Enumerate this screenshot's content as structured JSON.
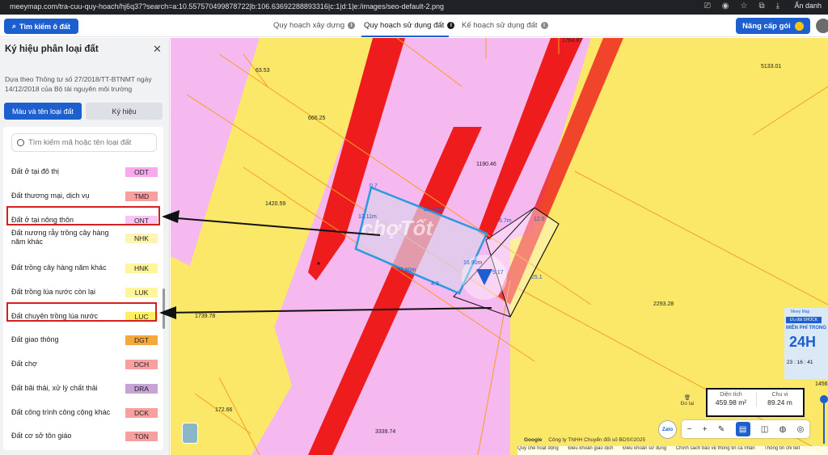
{
  "browser": {
    "url": "meeymap.com/tra-cuu-quy-hoach/hj6q37?search=a:10.557570499878722|b:106.63692288893316|c:1|d:1|e:/images/seo-default-2.png",
    "hide_label": "Ẩn danh"
  },
  "topnav": {
    "search_button": "Tìm kiếm ô đất",
    "tabs": [
      {
        "label": "Quy hoạch xây dựng"
      },
      {
        "label": "Quy hoạch sử dụng đất"
      },
      {
        "label": "Kế hoạch sử dụng đất"
      }
    ],
    "upgrade_button": "Nâng cấp gói"
  },
  "sidebar": {
    "title": "Ký hiệu phân loại đất",
    "description": "Dựa theo Thông tư số 27/2018/TT-BTNMT ngày 14/12/2018 của Bộ tài nguyên môi trường",
    "tab_color_name": "Màu và tên loại đất",
    "tab_symbol": "Ký hiệu",
    "search_placeholder": "Tìm kiếm mã hoặc tên loại đất",
    "items": [
      {
        "label": "Đất ở tại đô thị",
        "code": "ODT",
        "color": "#f7a8ee"
      },
      {
        "label": "Đất thương mại, dịch vụ",
        "code": "TMD",
        "color": "#f8a0a0"
      },
      {
        "label": "Đất ở tại nông thôn",
        "code": "ONT",
        "color": "#f9c5f3"
      },
      {
        "label": "Đất nương rẫy trồng cây hàng năm khác",
        "code": "NHK",
        "color": "#fff5b0"
      },
      {
        "label": "Đất trồng cây hàng năm khác",
        "code": "HNK",
        "color": "#fff59a"
      },
      {
        "label": "Đất trồng lúa nước còn lại",
        "code": "LUK",
        "color": "#fff59a"
      },
      {
        "label": "Đất chuyên trồng lúa nước",
        "code": "LUC",
        "color": "#fdee63"
      },
      {
        "label": "Đất giao thông",
        "code": "DGT",
        "color": "#f5a83c"
      },
      {
        "label": "Đất chợ",
        "code": "DCH",
        "color": "#f8a0a0"
      },
      {
        "label": "Đất bãi thải, xử lý chất thải",
        "code": "DRA",
        "color": "#c8a3d6"
      },
      {
        "label": "Đất công trình công cộng khác",
        "code": "DCK",
        "color": "#f8a0a0"
      },
      {
        "label": "Đất cơ sở tôn giáo",
        "code": "TON",
        "color": "#f8a0a0"
      }
    ]
  },
  "map": {
    "labels": [
      "1764.87",
      "5133.01",
      "63.53",
      "666.25",
      "1190.46",
      "1420.59",
      "29.43m",
      "13.11m",
      "27.90m",
      "16.90m",
      "12.5",
      "25.1",
      "2293.28",
      "1739.78",
      "172.66",
      "3339.74",
      "1456",
      "0.7",
      "6.7m",
      "5.17",
      "4.9"
    ],
    "watermark": "chợTốt",
    "area_label": "Diện tích",
    "area_value": "459.98 m²",
    "perimeter_label": "Chu vi",
    "perimeter_value": "89.24 m",
    "measure_label": "Đo lại",
    "zalo_label": "Zalo",
    "copyright": "Công ty TNHH Chuyển đổi số BDS©2025",
    "google": "Google",
    "footer_links": [
      "Quy chế hoạt động",
      "Điều khoản giao dịch",
      "Điều khoản sử dụng",
      "Chính sách bảo vệ thông tin cá nhân",
      "Thông tin chi tiết"
    ],
    "ad": {
      "brand": "Meey Map",
      "promo": "Ưu đãi SHOCK",
      "headline": "MIỄN PHÍ TRONG",
      "big": "24H",
      "timer": "23 : 16 : 41"
    },
    "colors": {
      "pink": "#f5b8ef",
      "red": "#ee1c1c",
      "yellow": "#fbe868",
      "boundary": "#2a9ae0"
    }
  }
}
